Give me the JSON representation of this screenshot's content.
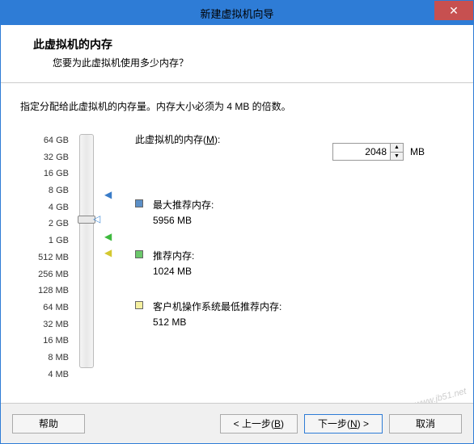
{
  "window": {
    "title": "新建虚拟机向导"
  },
  "header": {
    "title": "此虚拟机的内存",
    "subtitle": "您要为此虚拟机使用多少内存？"
  },
  "desc": "指定分配给此虚拟机的内存量。内存大小必须为 4 MB 的倍数。",
  "memory": {
    "label_prefix": "此虚拟机的内存(",
    "label_key": "M",
    "label_suffix": "):",
    "value": "2048",
    "unit": "MB"
  },
  "scale": [
    "64 GB",
    "32 GB",
    "16 GB",
    "8 GB",
    "4 GB",
    "2 GB",
    "1 GB",
    "512 MB",
    "256 MB",
    "128 MB",
    "64 MB",
    "32 MB",
    "16 MB",
    "8 MB",
    "4 MB"
  ],
  "recommend": {
    "max": {
      "label": "最大推荐内存:",
      "value": "5956 MB"
    },
    "rec": {
      "label": "推荐内存:",
      "value": "1024 MB"
    },
    "min": {
      "label": "客户机操作系统最低推荐内存:",
      "value": "512 MB"
    }
  },
  "buttons": {
    "help": "帮助",
    "back_pre": "< 上一步(",
    "back_key": "B",
    "back_suf": ")",
    "next_pre": "下一步(",
    "next_key": "N",
    "next_suf": ") >",
    "cancel": "取消"
  },
  "watermark": "www.jb51.net"
}
